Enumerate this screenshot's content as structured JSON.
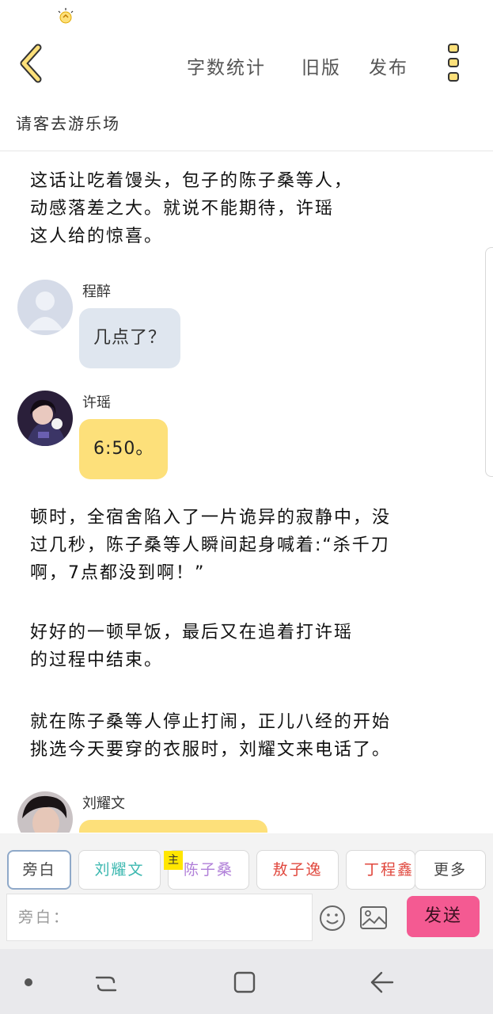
{
  "topbar": {
    "word_count": "字数统计",
    "old_version": "旧版",
    "publish": "发布"
  },
  "page_title": "请客去游乐场",
  "narration": [
    "这话让吃着馒头，包子的陈子桑等人，\n动感落差之大。就说不能期待，许瑶\n这人给的惊喜。",
    "顿时，全宿舍陷入了一片诡异的寂静中，没\n过几秒，陈子桑等人瞬间起身喊着:“杀千刀\n啊，7点都没到啊！”",
    "好好的一顿早饭，最后又在追着打许瑶\n的过程中结束。",
    "就在陈子桑等人停止打闹，正儿八经的开始\n挑选今天要穿的衣服时，刘耀文来电话了。"
  ],
  "messages": [
    {
      "speaker": "程醉",
      "text": "几点了？",
      "bubble": "gray",
      "avatar": "default-avatar"
    },
    {
      "speaker": "许瑶",
      "text": "6:50。",
      "bubble": "yellow",
      "avatar": "girl-photo-avatar"
    },
    {
      "speaker": "刘耀文",
      "text": "",
      "bubble": "yellow",
      "avatar": "boy-photo-avatar"
    }
  ],
  "roles": [
    {
      "label": "旁白",
      "color": "#444444",
      "active": true
    },
    {
      "label": "刘耀文",
      "color": "#3cb8b0"
    },
    {
      "label": "陈子桑",
      "color": "#b07fd8",
      "tag": "主"
    },
    {
      "label": "敖子逸",
      "color": "#e0473d"
    },
    {
      "label": "丁程鑫",
      "color": "#e0473d"
    },
    {
      "label": "更多",
      "color": "#444444"
    }
  ],
  "composer": {
    "placeholder": "旁白：",
    "send": "发送"
  },
  "colors": {
    "accent_yellow": "#fde07a",
    "send_pink": "#f45a92",
    "gray_bubble": "#dfe6ef"
  }
}
